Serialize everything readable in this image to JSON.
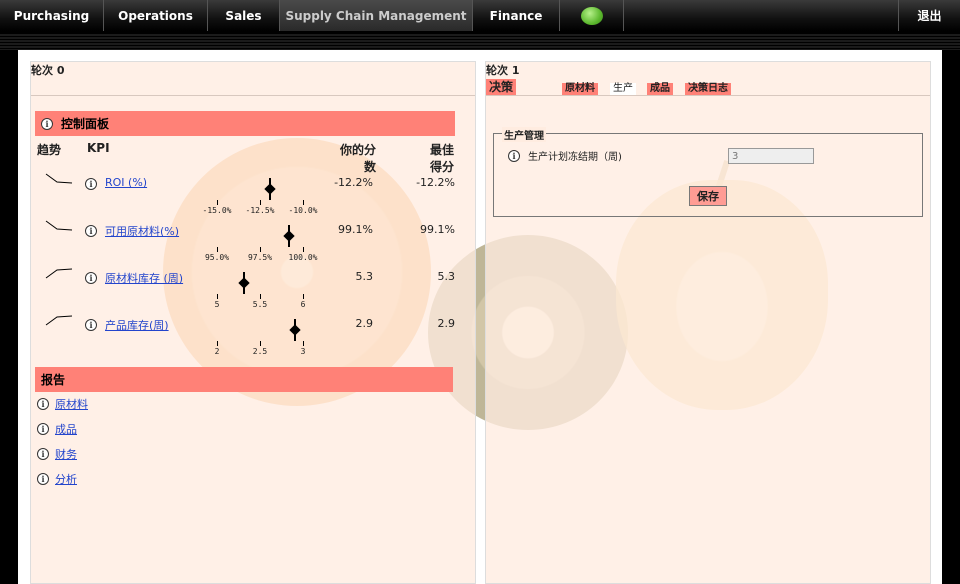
{
  "nav": {
    "items": [
      {
        "label": "Purchasing"
      },
      {
        "label": "Operations"
      },
      {
        "label": "Sales"
      },
      {
        "label": "Supply Chain Management"
      },
      {
        "label": "Finance"
      }
    ],
    "logout": "退出"
  },
  "left": {
    "round": "轮次 0",
    "dashboard_title": "控制面板",
    "headers": {
      "trend": "趋势",
      "kpi": "KPI",
      "your_score_1": "你的分",
      "your_score_2": "数",
      "best_1": "最佳",
      "best_2": "得分"
    },
    "kpis": [
      {
        "name": "ROI (%)",
        "your": "-12.2%",
        "best": "-12.2%",
        "ticks": [
          "-15.0%",
          "-12.5%",
          "-10.0%"
        ],
        "marker": 0.6
      },
      {
        "name": "可用原材料(%)",
        "your": "99.1%",
        "best": "99.1%",
        "ticks": [
          "95.0%",
          "97.5%",
          "100.0%"
        ],
        "marker": 0.82
      },
      {
        "name": "原材料库存 (周)",
        "your": "5.3",
        "best": "5.3",
        "ticks": [
          "5",
          "5.5",
          "6"
        ],
        "marker": 0.3
      },
      {
        "name": "产品库存(周)",
        "your": "2.9",
        "best": "2.9",
        "ticks": [
          "2",
          "2.5",
          "3"
        ],
        "marker": 0.9
      }
    ],
    "report_title": "报告",
    "reports": [
      "原材料",
      "成品",
      "财务",
      "分析"
    ]
  },
  "right": {
    "round": "轮次 1",
    "decision": "决策",
    "tabs": [
      "原材料",
      "生产",
      "成品",
      "决策日志"
    ],
    "active_tab": 1,
    "fieldset_legend": "生产管理",
    "field_label": "生产计划冻结期（周)",
    "field_value": "3",
    "save": "保存"
  }
}
